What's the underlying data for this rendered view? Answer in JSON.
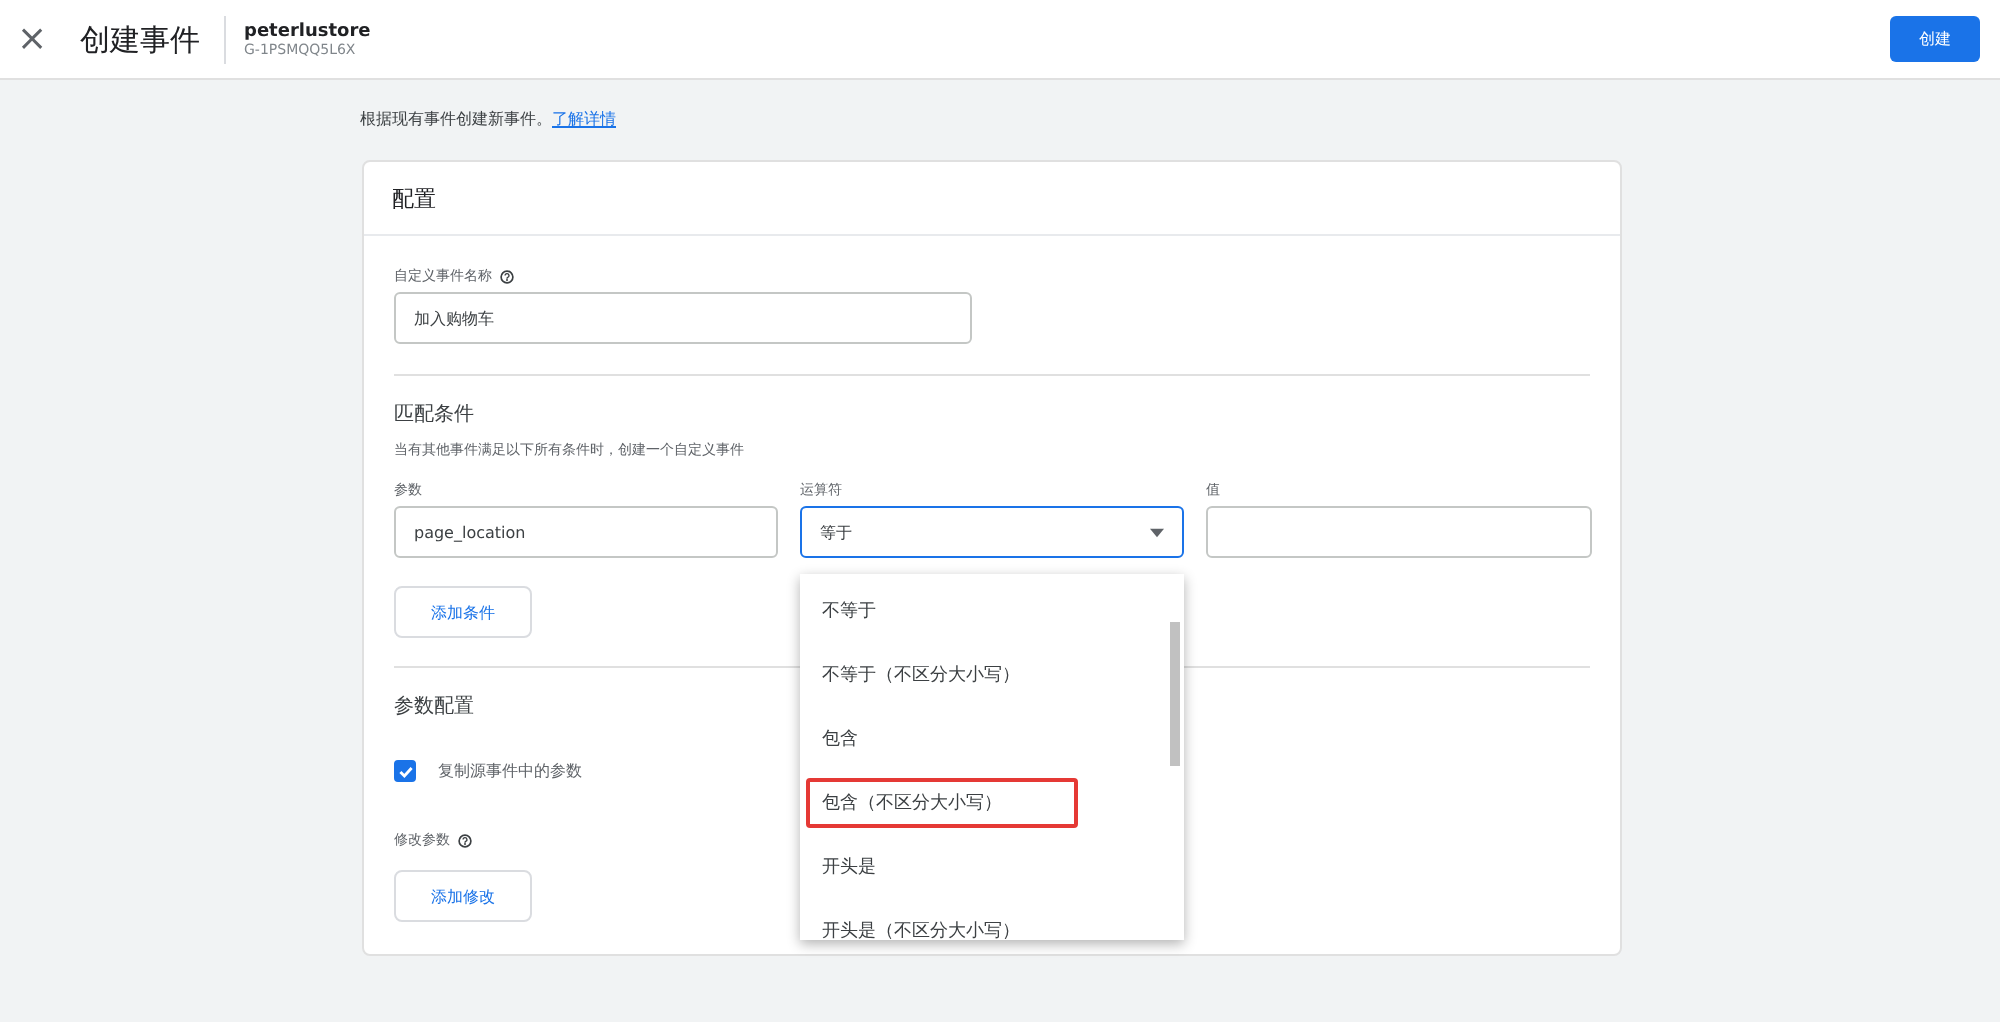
{
  "header": {
    "close_icon": "×",
    "title": "创建事件",
    "account": "peterlustore",
    "property_id": "G-1PSMQQ5L6X",
    "primary_button": "创建"
  },
  "intro": {
    "text": "根据现有事件创建新事件。",
    "link": "了解详情"
  },
  "card": {
    "title": "配置",
    "event_name": {
      "label": "自定义事件名称",
      "value": "加入购物车"
    },
    "match": {
      "title": "匹配条件",
      "description": "当有其他事件满足以下所有条件时，创建一个自定义事件",
      "parameter": {
        "label": "参数",
        "value": "page_location"
      },
      "operator": {
        "label": "运算符",
        "value": "等于",
        "expanded": true
      },
      "value_field": {
        "label": "值"
      },
      "add_button": "添加条件"
    },
    "params": {
      "title": "参数配置",
      "copy": {
        "label": "复制源事件中的参数",
        "checked": true
      },
      "modify_label": "修改参数",
      "add_button": "添加修改"
    }
  },
  "operator_menu": [
    {
      "label": "不等于",
      "highlighted": false
    },
    {
      "label": "不等于（不区分大小写）",
      "highlighted": false
    },
    {
      "label": "包含",
      "highlighted": false
    },
    {
      "label": "包含（不区分大小写）",
      "highlighted": true
    },
    {
      "label": "开头是",
      "highlighted": false
    },
    {
      "label": "开头是（不区分大小写）",
      "highlighted": false
    }
  ]
}
